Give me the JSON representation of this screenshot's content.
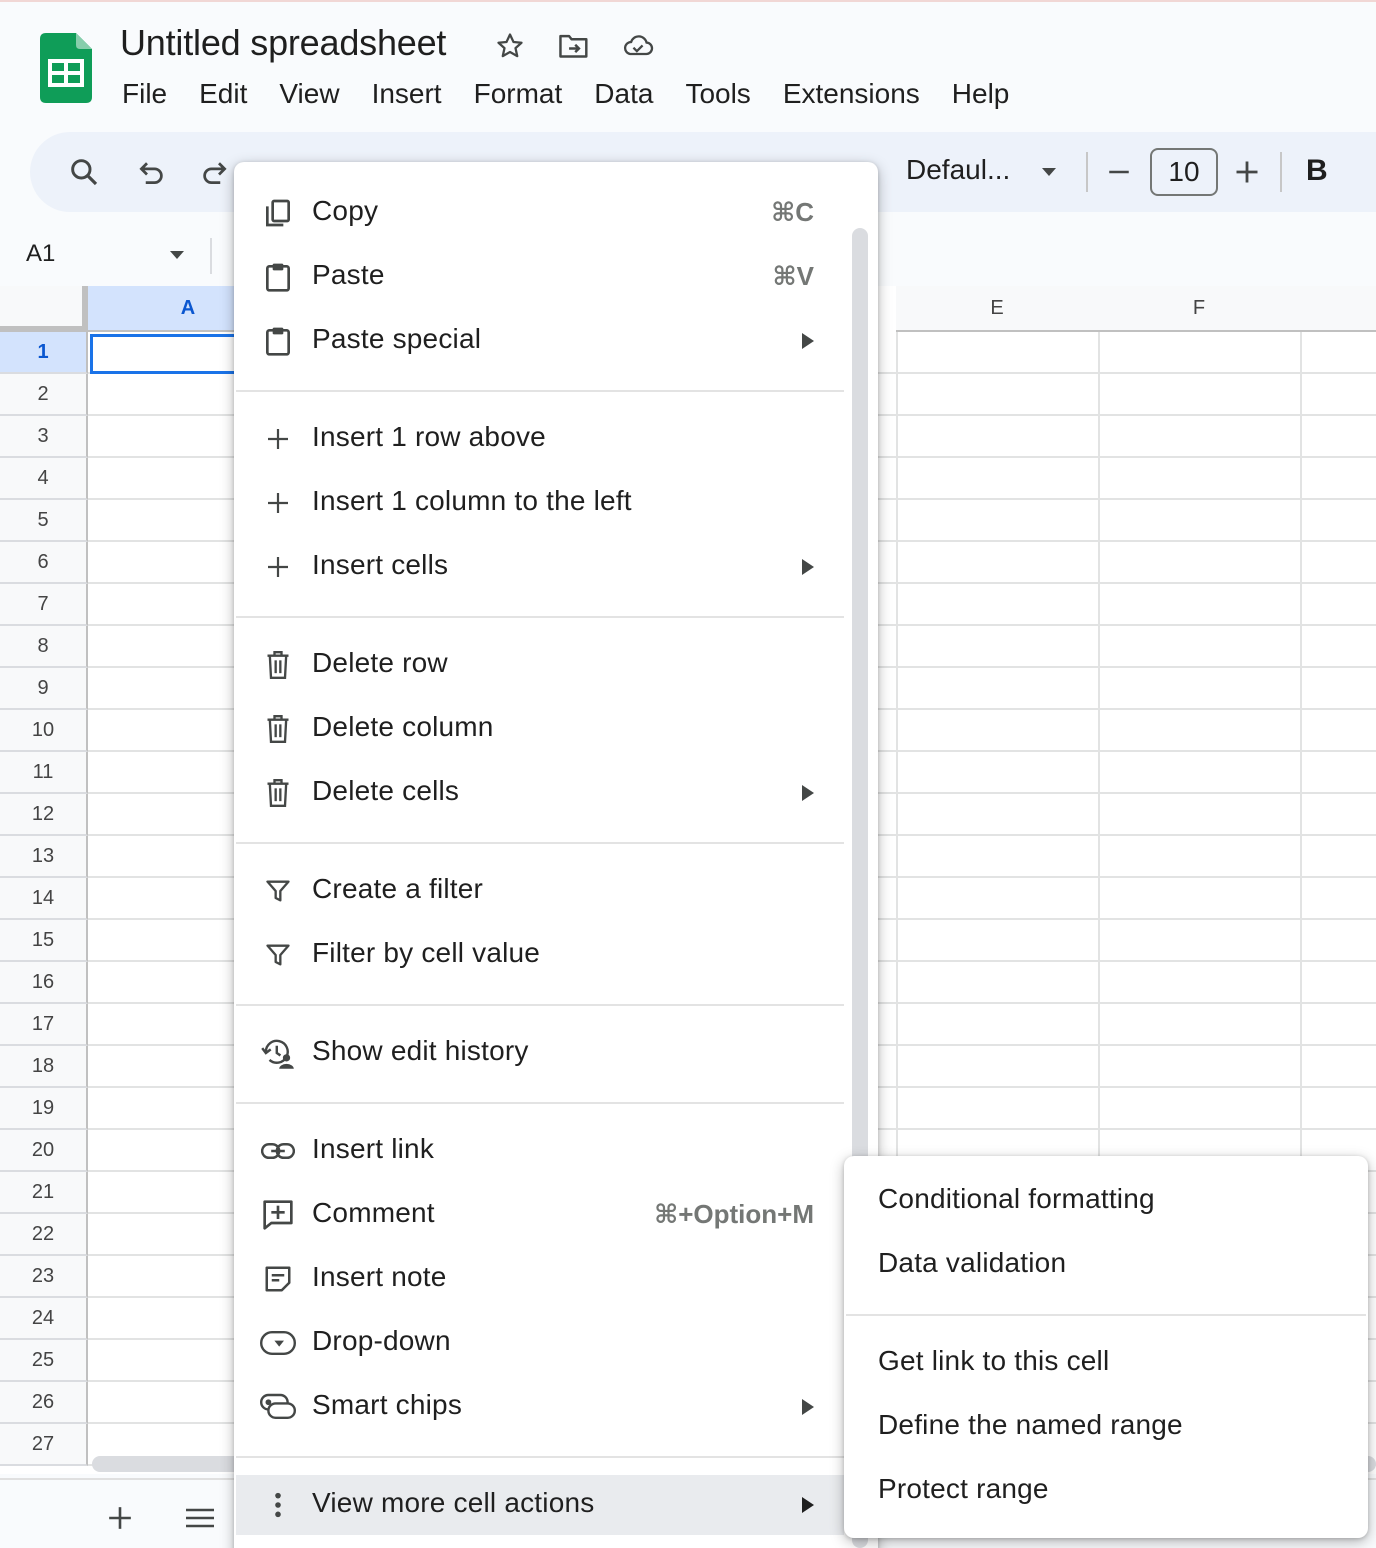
{
  "document": {
    "title": "Untitled spreadsheet"
  },
  "menubar": [
    "File",
    "Edit",
    "View",
    "Insert",
    "Format",
    "Data",
    "Tools",
    "Extensions",
    "Help"
  ],
  "toolbar": {
    "font_name": "Defaul...",
    "font_size": "10",
    "bold_label": "B"
  },
  "formula_bar": {
    "cell_ref": "A1"
  },
  "grid": {
    "columns": [
      "A",
      "E",
      "F"
    ],
    "rows": [
      "1",
      "2",
      "3",
      "4",
      "5",
      "6",
      "7",
      "8",
      "9",
      "10",
      "11",
      "12",
      "13",
      "14",
      "15",
      "16",
      "17",
      "18",
      "19",
      "20",
      "21",
      "22",
      "23",
      "24",
      "25",
      "26",
      "27"
    ]
  },
  "context_menu": {
    "copy": {
      "label": "Copy",
      "shortcut": "⌘C"
    },
    "paste": {
      "label": "Paste",
      "shortcut": "⌘V"
    },
    "paste_special": {
      "label": "Paste special"
    },
    "insert_row": {
      "label": "Insert 1 row above"
    },
    "insert_column": {
      "label": "Insert 1 column to the left"
    },
    "insert_cells": {
      "label": "Insert cells"
    },
    "delete_row": {
      "label": "Delete row"
    },
    "delete_column": {
      "label": "Delete column"
    },
    "delete_cells": {
      "label": "Delete cells"
    },
    "create_filter": {
      "label": "Create a filter"
    },
    "filter_by_value": {
      "label": "Filter by cell value"
    },
    "edit_history": {
      "label": "Show edit history"
    },
    "insert_link": {
      "label": "Insert link"
    },
    "comment": {
      "label": "Comment",
      "shortcut": "⌘+Option+M"
    },
    "insert_note": {
      "label": "Insert note"
    },
    "dropdown": {
      "label": "Drop-down"
    },
    "smart_chips": {
      "label": "Smart chips"
    },
    "more_actions": {
      "label": "View more cell actions"
    }
  },
  "submenu": {
    "conditional_formatting": "Conditional formatting",
    "data_validation": "Data validation",
    "get_link": "Get link to this cell",
    "named_range": "Define the named range",
    "protect_range": "Protect range"
  },
  "colors": {
    "accent": "#1a73e8",
    "sheets_green": "#0f9d58",
    "toolbar_bg": "#edf2fa",
    "selection": "#d3e3fd"
  }
}
